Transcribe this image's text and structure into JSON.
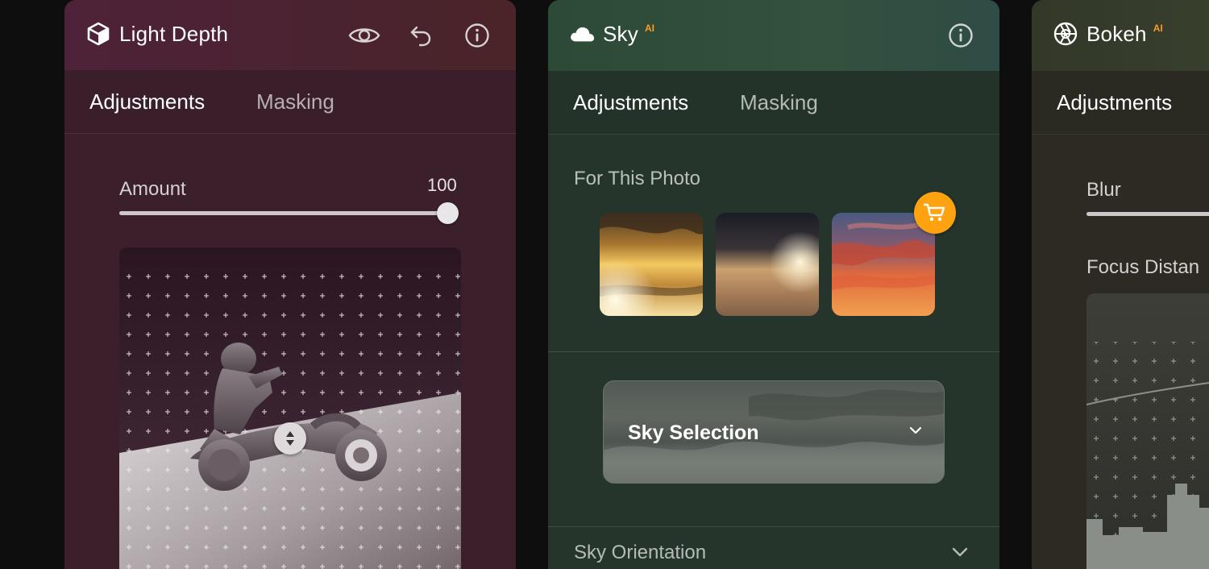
{
  "panels": {
    "light_depth": {
      "title": "Light Depth",
      "tabs": [
        "Adjustments",
        "Masking"
      ],
      "amount_label": "Amount",
      "amount_value": "100",
      "amount_fraction": 1.0
    },
    "sky": {
      "title": "Sky",
      "ai_badge": "AI",
      "tabs": [
        "Adjustments",
        "Masking"
      ],
      "section_title": "For This Photo",
      "selection_label": "Sky Selection",
      "orientation_label": "Sky Orientation"
    },
    "bokeh": {
      "title": "Bokeh",
      "ai_badge": "AI",
      "tabs": [
        "Adjustments"
      ],
      "blur_label": "Blur",
      "focus_label": "Focus Distan"
    }
  },
  "colors": {
    "accent_orange": "#ffa210",
    "ai_badge": "#ff9a1f"
  },
  "icons": [
    "cube-icon",
    "eye-icon",
    "undo-icon",
    "info-icon",
    "cloud-icon",
    "aperture-icon",
    "cart-icon",
    "chevron-down-icon",
    "updown-handle-icon"
  ]
}
